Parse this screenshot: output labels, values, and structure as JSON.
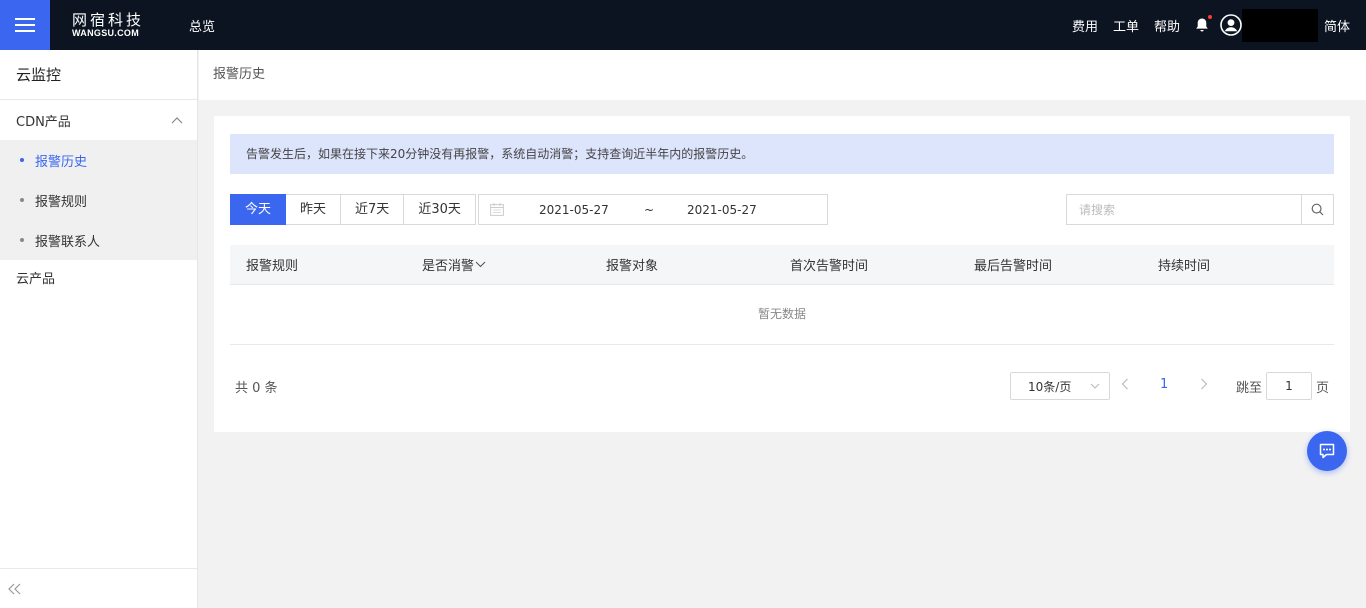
{
  "topbar": {
    "logo_cn": "网宿科技",
    "logo_en": "WANGSU.COM",
    "overview": "总览",
    "links": [
      "费用",
      "工单",
      "帮助"
    ],
    "language": "简体"
  },
  "sidebar": {
    "title": "云监控",
    "group": {
      "label": "CDN产品",
      "items": [
        {
          "label": "报警历史",
          "active": true
        },
        {
          "label": "报警规则",
          "active": false
        },
        {
          "label": "报警联系人",
          "active": false
        }
      ]
    },
    "other_label": "云产品"
  },
  "breadcrumb": "报警历史",
  "notice": "告警发生后，如果在接下来20分钟没有再报警，系统自动消警；支持查询近半年内的报警历史。",
  "filters": {
    "date_tabs": [
      "今天",
      "昨天",
      "近7天",
      "近30天"
    ],
    "active_tab": "今天",
    "range": {
      "start": "2021-05-27",
      "separator": "~",
      "end": "2021-05-27"
    },
    "search_placeholder": "请搜索"
  },
  "table": {
    "columns": [
      "报警规则",
      "是否消警",
      "报警对象",
      "首次告警时间",
      "最后告警时间",
      "持续时间"
    ],
    "empty_text": "暂无数据"
  },
  "pagination": {
    "total_text": "共 0 条",
    "page_size": "10条/页",
    "current_page": "1",
    "jump_label": "跳至",
    "jump_value": "1",
    "page_suffix": "页"
  },
  "colors": {
    "accent": "#3b67f0",
    "topbar": "#0c1421",
    "notice_bg": "#dde5fd",
    "badge_dot": "#ff3b30"
  },
  "icons": [
    "menu-icon",
    "bell-icon",
    "user-icon",
    "chevron-up-icon",
    "calendar-icon",
    "search-icon",
    "chevron-down-icon",
    "chevron-left-icon",
    "chevron-right-icon",
    "collapse-icon",
    "chat-icon"
  ]
}
